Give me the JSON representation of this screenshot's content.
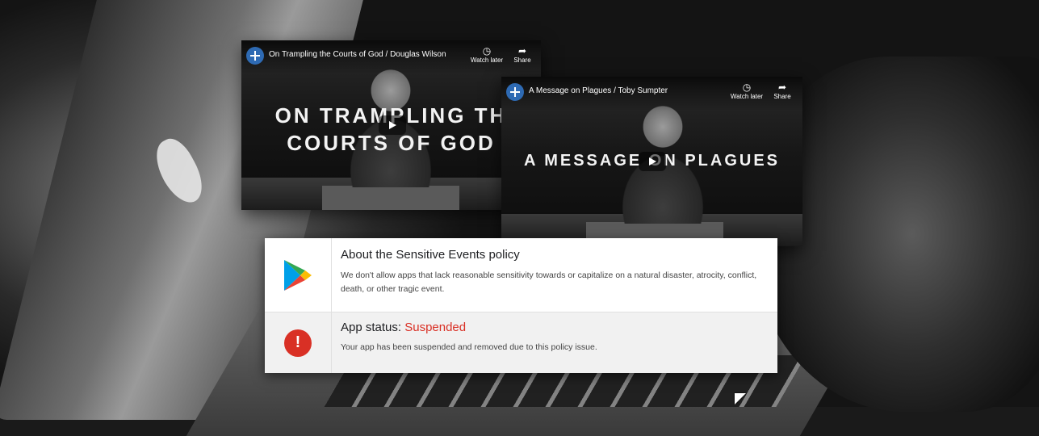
{
  "videos": [
    {
      "title": "On Trampling the Courts of God / Douglas Wilson",
      "overlay_line1": "ON TRAMPLING TH",
      "overlay_line2": "COURTS OF GOD",
      "watch_later": "Watch later",
      "share": "Share"
    },
    {
      "title": "A Message on Plagues / Toby Sumpter",
      "overlay_line1": "A MESSAGE ON PLAGUES",
      "watch_later": "Watch later",
      "share": "Share"
    }
  ],
  "policy": {
    "title": "About the Sensitive Events policy",
    "body": "We don't allow apps that lack reasonable sensitivity towards or capitalize on a natural disaster, atrocity, conflict, death, or other tragic event.",
    "status_label": "App status: ",
    "status_value": "Suspended",
    "status_body": "Your app has been suspended and removed due to this policy issue.",
    "status_color": "#d93025"
  },
  "icons": {
    "play_store": "play-store-icon",
    "alert": "alert-icon",
    "clock": "clock-icon",
    "share": "share-icon",
    "play": "play-icon",
    "cursor": "mouse-cursor-icon"
  }
}
